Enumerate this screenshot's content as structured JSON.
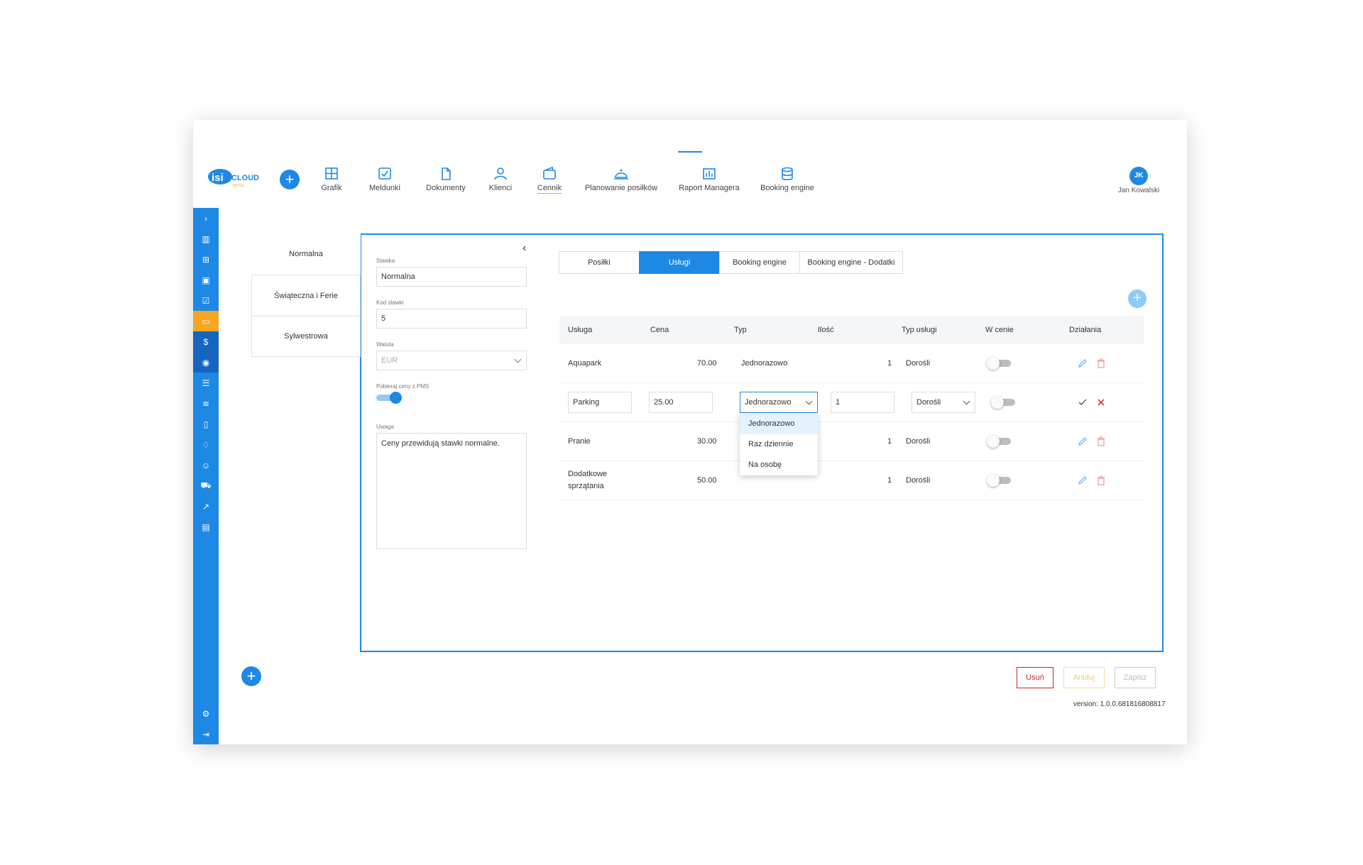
{
  "app": {
    "logo_text": "CLOUD",
    "user_initials": "JK",
    "user_name": "Jan Kowalski",
    "version": "version: 1.0.0.681816808817"
  },
  "nav": [
    {
      "label": "Grafik",
      "icon": "grid-icon"
    },
    {
      "label": "Meldunki",
      "icon": "checkbox-icon"
    },
    {
      "label": "Dokumenty",
      "icon": "document-icon"
    },
    {
      "label": "Klienci",
      "icon": "person-icon"
    },
    {
      "label": "Cennik",
      "icon": "wallet-icon"
    },
    {
      "label": "Planowanie posiłków",
      "icon": "cloche-icon"
    },
    {
      "label": "Raport Managera",
      "icon": "report-icon"
    },
    {
      "label": "Booking engine",
      "icon": "database-icon"
    }
  ],
  "rates": [
    "Normalna",
    "Świąteczna i Ferie",
    "Sylwestrowa"
  ],
  "form": {
    "stawka_label": "Stawka",
    "stawka_value": "Normalna",
    "kod_label": "Kod stawki",
    "kod_value": "5",
    "waluta_label": "Waluta",
    "waluta_value": "EUR",
    "pms_label": "Pobieraj ceny z PMS",
    "uwaga_label": "Uwaga",
    "uwaga_value": "Ceny przewidują stawki normalne."
  },
  "tabs": [
    "Posiłki",
    "Usługi",
    "Booking engine",
    "Booking engine - Dodatki"
  ],
  "table": {
    "headers": [
      "Usługa",
      "Cena",
      "Typ",
      "Ilość",
      "Typ usługi",
      "W cenie",
      "Działania"
    ],
    "rows": [
      {
        "name": "Aquapark",
        "price": "70.00",
        "type": "Jednorazowo",
        "qty": "1",
        "service_type": "Dorośli"
      },
      {
        "name": "Pranie",
        "price": "30.00",
        "type": "",
        "qty": "1",
        "service_type": "Dorośli"
      },
      {
        "name": "Dodatkowe sprzątania",
        "price": "50.00",
        "type": "",
        "qty": "1",
        "service_type": "Dorośli"
      }
    ],
    "edit_row": {
      "name": "Parking",
      "price": "25.00",
      "type": "Jednorazowo",
      "qty": "1",
      "service_type": "Dorośli"
    },
    "type_options": [
      "Jednorazowo",
      "Raz dziennie",
      "Na osobę"
    ]
  },
  "buttons": {
    "delete": "Usuń",
    "cancel": "Anuluj",
    "save": "Zapisz"
  },
  "colors": {
    "primary": "#1e88e5",
    "accent": "#f5a623",
    "danger": "#c62828"
  }
}
